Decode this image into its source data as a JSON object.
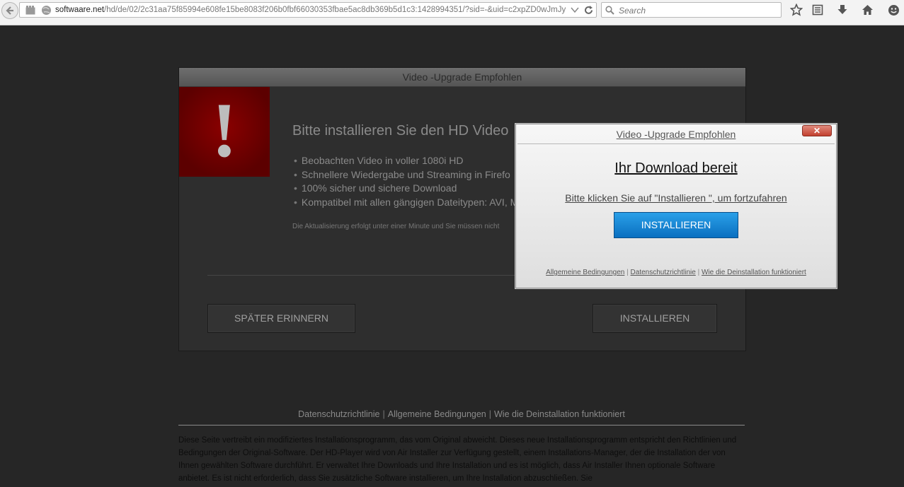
{
  "browser": {
    "url_host": "softwaare.net",
    "url_path": "/hd/de/02/2c31aa75f85994e608fe15be8083f206b0fbf66030353fbae5ac8db369b5d1c3:1428994351/?sid=-&uid=c2xpZD0wJmJy",
    "search_placeholder": "Search",
    "icons": [
      "back-icon",
      "tab-group-icon",
      "globe-icon",
      "dropdown-icon",
      "reload-icon",
      "search-icon",
      "bookmark-star-icon",
      "reading-list-icon",
      "download-icon",
      "home-icon",
      "smiley-icon"
    ]
  },
  "panel": {
    "title": "Video -Upgrade Empfohlen",
    "warning_symbol": "!",
    "headline": "Bitte installieren Sie den HD Video",
    "features": [
      "Beobachten Video in voller 1080i HD",
      "Schnellere Wiedergabe und Streaming in Firefo",
      "100% sicher und sichere Download",
      "Kompatibel mit allen gängigen Dateitypen: AVI, M"
    ],
    "note": "Die Aktualisierung erfolgt unter einer Minute und Sie müssen nicht",
    "later_button": "SPÄTER ERINNERN",
    "install_button": "INSTALLIEREN"
  },
  "popup": {
    "title": "Video -Upgrade Empfohlen",
    "close_symbol": "✕",
    "heading": "Ihr Download bereit",
    "subtitle": "Bitte klicken Sie auf \"Installieren \", um fortzufahren",
    "install_button": "INSTALLIEREN",
    "links": [
      "Allgemeine Bedingungen",
      "Datenschutzrichtlinie",
      "Wie die Deinstallation funktioniert"
    ],
    "link_separator": "|"
  },
  "footer": {
    "links": [
      "Datenschutzrichtlinie",
      "Allgemeine Bedingungen",
      "Wie die Deinstallation funktioniert"
    ],
    "separator": "|",
    "disclaimer": "Diese Seite vertreibt ein modifiziertes Installationsprogramm, das vom Original abweicht. Dieses neue Installationsprogramm entspricht den Richtlinien und Bedingungen der Original-Software. Der HD-Player wird von Air Installer zur Verfügung gestellt, einem Installations-Manager, der die Installation der von Ihnen gewählten Software durchführt. Er verwaltet Ihre Downloads und Ihre Installation und es ist möglich, dass Air Installer Ihnen optionale Software anbietet. Es ist nicht erforderlich, dass Sie zusätzliche Software installieren, um Ihre Installation abzuschließen. Sie"
  },
  "colors": {
    "page_bg": "#262626",
    "warning_red": "#7a0000",
    "popup_button": "#1188d8"
  }
}
